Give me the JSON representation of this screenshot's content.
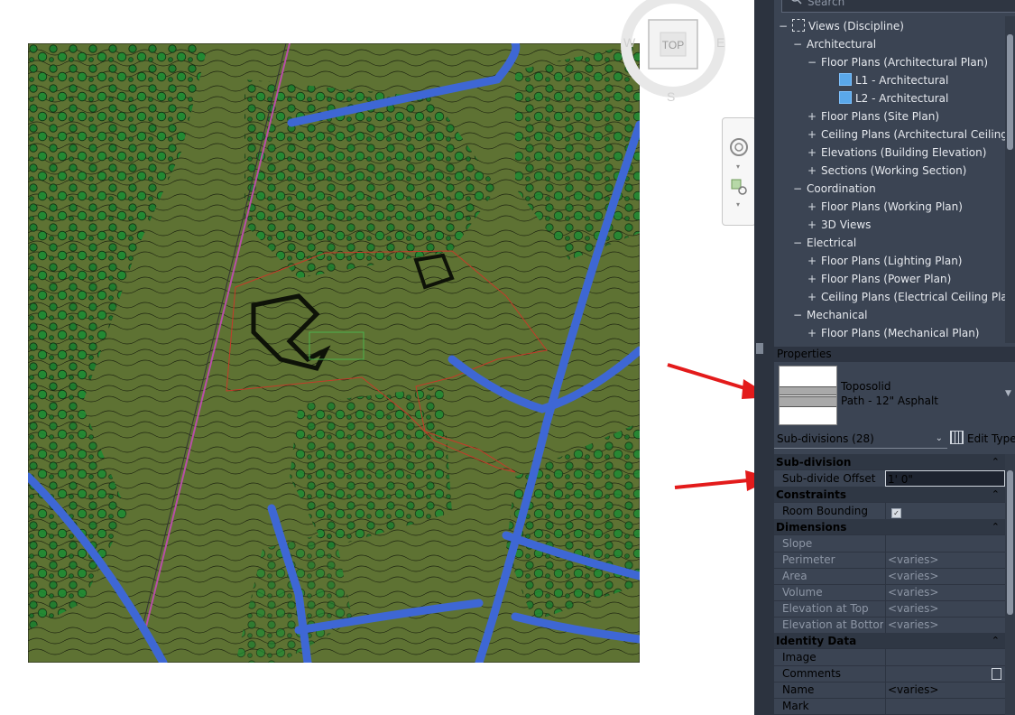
{
  "viewcube": {
    "face": "TOP",
    "west": "W",
    "east": "E",
    "south": "S"
  },
  "browser": {
    "search_placeholder": "Search",
    "items": [
      {
        "label": "Views (Discipline)",
        "toggle": "−",
        "icon": "views-icon"
      },
      {
        "label": "Architectural",
        "toggle": "−"
      },
      {
        "label": "Floor Plans (Architectural Plan)",
        "toggle": "−"
      },
      {
        "label": "L1 - Architectural",
        "icon": "view-icon"
      },
      {
        "label": "L2 - Architectural",
        "icon": "view-icon"
      },
      {
        "label": "Floor Plans (Site Plan)",
        "toggle": "+"
      },
      {
        "label": "Ceiling Plans (Architectural Ceiling Plan)",
        "toggle": "+"
      },
      {
        "label": "Elevations (Building Elevation)",
        "toggle": "+"
      },
      {
        "label": "Sections (Working Section)",
        "toggle": "+"
      },
      {
        "label": "Coordination",
        "toggle": "−"
      },
      {
        "label": "Floor Plans (Working Plan)",
        "toggle": "+"
      },
      {
        "label": "3D Views",
        "toggle": "+"
      },
      {
        "label": "Electrical",
        "toggle": "−"
      },
      {
        "label": "Floor Plans (Lighting Plan)",
        "toggle": "+"
      },
      {
        "label": "Floor Plans (Power Plan)",
        "toggle": "+"
      },
      {
        "label": "Ceiling Plans (Electrical Ceiling Plan)",
        "toggle": "+"
      },
      {
        "label": "Mechanical",
        "toggle": "−"
      },
      {
        "label": "Floor Plans (Mechanical Plan)",
        "toggle": "+"
      }
    ]
  },
  "properties": {
    "title": "Properties",
    "type_family": "Toposolid",
    "type_name": "Path - 12\" Asphalt",
    "filter": "Sub-divisions (28)",
    "edit_type": "Edit Type",
    "groups": [
      {
        "name": "Sub-division",
        "rows": [
          {
            "name": "Sub-divide Offset",
            "value": "1'  0\"",
            "editing": true
          }
        ]
      },
      {
        "name": "Constraints",
        "rows": [
          {
            "name": "Room Bounding",
            "checkbox": true,
            "check_glyph": "✓"
          }
        ]
      },
      {
        "name": "Dimensions",
        "rows": [
          {
            "name": "Slope",
            "value": "",
            "disabled": true
          },
          {
            "name": "Perimeter",
            "value": "<varies>",
            "disabled": true
          },
          {
            "name": "Area",
            "value": "<varies>",
            "disabled": true
          },
          {
            "name": "Volume",
            "value": "<varies>",
            "disabled": true
          },
          {
            "name": "Elevation at Top",
            "value": "<varies>",
            "disabled": true
          },
          {
            "name": "Elevation at Bottom",
            "value": "<varies>",
            "disabled": true
          }
        ]
      },
      {
        "name": "Identity Data",
        "rows": [
          {
            "name": "Image",
            "value": ""
          },
          {
            "name": "Comments",
            "value": "",
            "box": true
          },
          {
            "name": "Name",
            "value": "<varies>"
          },
          {
            "name": "Mark",
            "value": ""
          }
        ]
      }
    ],
    "collapse_glyph": "⌃"
  },
  "colors": {
    "terrain": "#5e7233",
    "tree": "#1c7d2f",
    "road": "#3e67d4",
    "panel": "#3b4453",
    "annotation_arrow": "#e31b1b"
  }
}
